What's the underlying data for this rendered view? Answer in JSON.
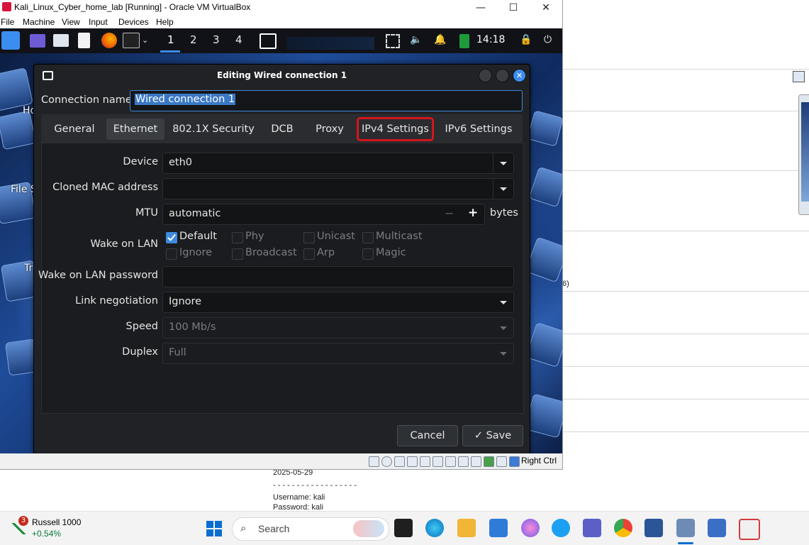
{
  "host_window": {
    "title": "Kali_Linux_Cyber_home_lab [Running] - Oracle VM VirtualBox",
    "controls": {
      "minimize": "—",
      "maximize": "☐",
      "close": "✕"
    },
    "menu": [
      "File",
      "Machine",
      "View",
      "Input",
      "Devices",
      "Help"
    ],
    "status_host_key": "Right Ctrl"
  },
  "kali_panel": {
    "workspaces": [
      "1",
      "2",
      "3",
      "4"
    ],
    "clock": "14:18"
  },
  "desktop_icons": [
    "Ho",
    "File S",
    "Tr"
  ],
  "dialog": {
    "title": "Editing Wired connection 1",
    "connection_name_label": "Connection name",
    "connection_name_value": "Wired connection 1",
    "tabs": [
      "General",
      "Ethernet",
      "802.1X Security",
      "DCB",
      "Proxy",
      "IPv4 Settings",
      "IPv6 Settings"
    ],
    "active_tab": "Ethernet",
    "highlighted_tab": "IPv4 Settings",
    "fields": {
      "device_label": "Device",
      "device_value": "eth0",
      "cloned_mac_label": "Cloned MAC address",
      "cloned_mac_value": "",
      "mtu_label": "MTU",
      "mtu_value": "automatic",
      "mtu_minus": "−",
      "mtu_plus": "+",
      "mtu_unit": "bytes",
      "wol_label": "Wake on LAN",
      "wol_options": {
        "default": "Default",
        "phy": "Phy",
        "unicast": "Unicast",
        "multicast": "Multicast",
        "ignore": "Ignore",
        "broadcast": "Broadcast",
        "arp": "Arp",
        "magic": "Magic"
      },
      "wol_password_label": "Wake on LAN password",
      "wol_password_value": "",
      "link_negotiation_label": "Link negotiation",
      "link_negotiation_value": "Ignore",
      "speed_label": "Speed",
      "speed_value": "100 Mb/s",
      "duplex_label": "Duplex",
      "duplex_value": "Full"
    },
    "cancel_label": "Cancel",
    "save_label": "✓ Save"
  },
  "background_doc": {
    "lines": [
      "2025-05-29",
      "- - - - - - - - - - - - - - - - - -",
      "Username: kali",
      "Password: kali"
    ],
    "fragment": "6)"
  },
  "taskbar": {
    "stock_badge": "3",
    "stock_name": "Russell 1000",
    "stock_change": "+0.54%",
    "search_placeholder": "Search"
  },
  "colors": {
    "accent": "#3d8bde",
    "highlight_box": "#d4161e",
    "dialog_bg": "#202225",
    "stock_change": "#0b7a3a"
  }
}
